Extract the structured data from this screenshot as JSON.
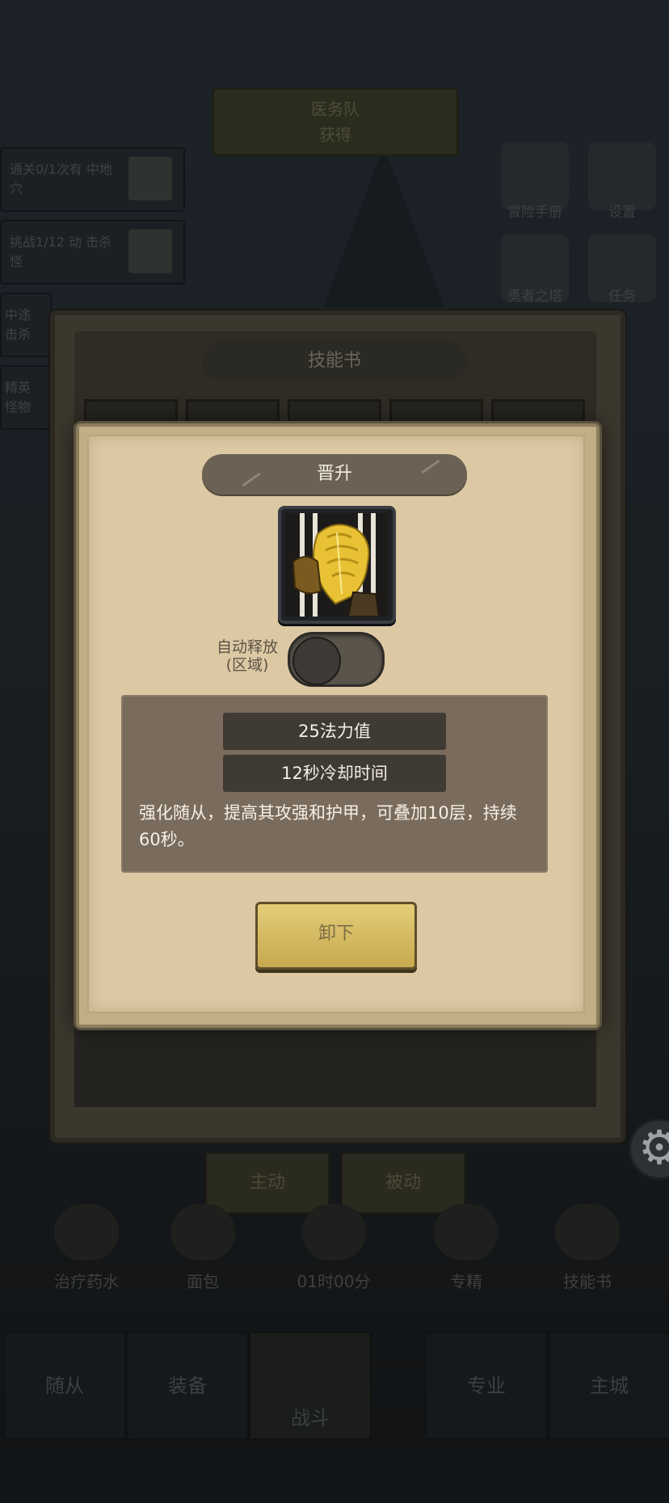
{
  "background": {
    "banner": {
      "line1": "医务队",
      "line2": "获得"
    },
    "quests": [
      {
        "text": "通关0/1次有 中地穴"
      },
      {
        "text": "挑战1/12 动 击杀怪"
      },
      {
        "text": "中途 击杀"
      },
      {
        "text": "精英 怪物"
      }
    ],
    "side_icons": [
      {
        "label": "冒险手册",
        "icon": "book-icon"
      },
      {
        "label": "设置",
        "icon": "gear-icon"
      },
      {
        "label": "勇者之塔",
        "icon": "tower-icon"
      },
      {
        "label": "任务",
        "icon": "scroll-icon"
      }
    ],
    "skill_tabs": [
      "主动",
      "被动"
    ],
    "items": [
      {
        "label": "治疗药水"
      },
      {
        "label": "面包"
      },
      {
        "label": "01时00分"
      },
      {
        "label": "专精"
      },
      {
        "label": "技能书"
      }
    ],
    "nav": [
      "随从",
      "装备",
      "战斗",
      "专业",
      "主城"
    ]
  },
  "outer_panel": {
    "title": "技能书"
  },
  "dialog": {
    "title": "晋升",
    "auto_cast_label_line1": "自动释放",
    "auto_cast_label_line2": "(区域)",
    "auto_cast_enabled": false,
    "stats": [
      "25法力值",
      "12秒冷却时间"
    ],
    "description": "强化随从，提高其攻强和护甲，可叠加10层，持续60秒。",
    "unequip_label": "卸下"
  },
  "colors": {
    "paper": "#dcc9a4",
    "pill": "#6b6253",
    "info_box": "#7a6c5c",
    "button_gold": "#d8bd63"
  }
}
